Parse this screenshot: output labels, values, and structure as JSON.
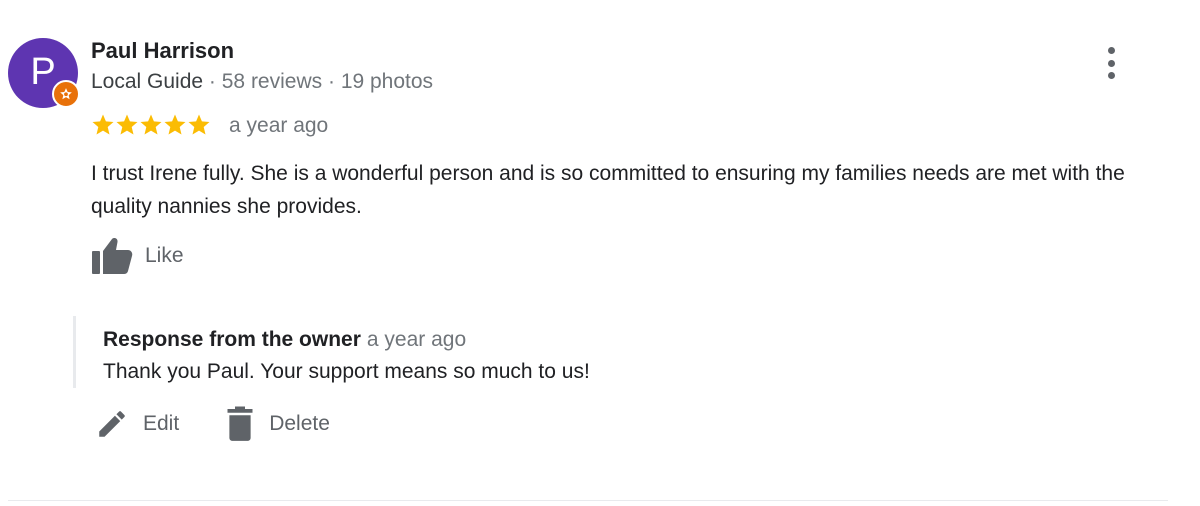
{
  "reviewer": {
    "name": "Paul Harrison",
    "initial": "P",
    "avatar_color": "#5e35b1",
    "badge_color": "#e8710a",
    "badge_icon": "local-guide-star-icon",
    "role": "Local Guide",
    "separator": " · ",
    "reviews": "58 reviews",
    "photos": "19 photos"
  },
  "review": {
    "rating": 5,
    "max_rating": 5,
    "star_color": "#fbbc04",
    "time": "a year ago",
    "text": "I trust Irene fully. She is a wonderful person and is so committed to ensuring my families needs are met with the quality nannies she provides."
  },
  "like": {
    "icon": "thumb-up-icon",
    "label": "Like"
  },
  "more_menu": {
    "icon": "more-vert-icon"
  },
  "owner_response": {
    "title": "Response from the owner",
    "time": "a year ago",
    "text": "Thank you Paul. Your support means so much to us!"
  },
  "actions": {
    "edit": {
      "icon": "pencil-icon",
      "label": "Edit"
    },
    "delete": {
      "icon": "trash-icon",
      "label": "Delete"
    }
  }
}
